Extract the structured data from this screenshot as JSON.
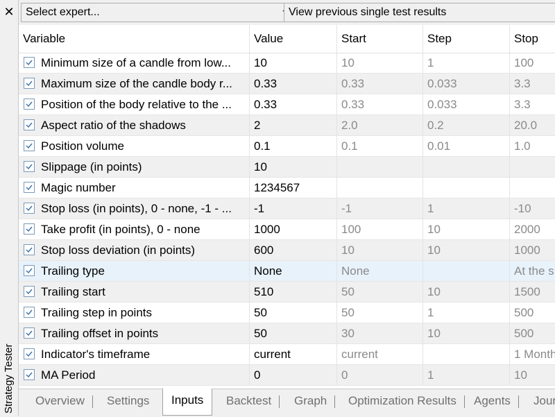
{
  "panel": {
    "title": "Strategy Tester",
    "close": "✕"
  },
  "toolbar": {
    "expert_select": "Select expert...",
    "view_prev": "View previous single test results"
  },
  "columns": [
    "Variable",
    "Value",
    "Start",
    "Step",
    "Stop"
  ],
  "rows": [
    {
      "variable": "Minimum size of a candle from low...",
      "value": "10",
      "start": "10",
      "step": "1",
      "stop": "100",
      "checked": true
    },
    {
      "variable": "Maximum size of the candle body r...",
      "value": "0.33",
      "start": "0.33",
      "step": "0.033",
      "stop": "3.3",
      "checked": true
    },
    {
      "variable": "Position of the body relative to the ...",
      "value": "0.33",
      "start": "0.33",
      "step": "0.033",
      "stop": "3.3",
      "checked": true
    },
    {
      "variable": "Aspect ratio of the shadows",
      "value": "2",
      "start": "2.0",
      "step": "0.2",
      "stop": "20.0",
      "checked": true
    },
    {
      "variable": "Position volume",
      "value": "0.1",
      "start": "0.1",
      "step": "0.01",
      "stop": "1.0",
      "checked": true
    },
    {
      "variable": "Slippage (in points)",
      "value": "10",
      "start": "",
      "step": "",
      "stop": "",
      "checked": true
    },
    {
      "variable": "Magic number",
      "value": "1234567",
      "start": "",
      "step": "",
      "stop": "",
      "checked": true
    },
    {
      "variable": "Stop loss (in points), 0 - none, -1 - ...",
      "value": "-1",
      "start": "-1",
      "step": "1",
      "stop": "-10",
      "checked": true
    },
    {
      "variable": "Take profit (in points), 0 - none",
      "value": "1000",
      "start": "100",
      "step": "10",
      "stop": "2000",
      "checked": true
    },
    {
      "variable": "Stop loss deviation (in points)",
      "value": "600",
      "start": "10",
      "step": "10",
      "stop": "1000",
      "checked": true
    },
    {
      "variable": "Trailing type",
      "value": "None",
      "start": "None",
      "step": "",
      "stop": "At the s",
      "checked": true,
      "selected": true
    },
    {
      "variable": "Trailing start",
      "value": "510",
      "start": "50",
      "step": "10",
      "stop": "1500",
      "checked": true
    },
    {
      "variable": "Trailing step in points",
      "value": "50",
      "start": "50",
      "step": "1",
      "stop": "500",
      "checked": true
    },
    {
      "variable": "Trailing offset in points",
      "value": "50",
      "start": "30",
      "step": "10",
      "stop": "500",
      "checked": true
    },
    {
      "variable": "Indicator's timeframe",
      "value": "current",
      "start": "current",
      "step": "",
      "stop": "1 Month",
      "checked": true
    },
    {
      "variable": "MA Period",
      "value": "0",
      "start": "0",
      "step": "1",
      "stop": "10",
      "checked": true
    }
  ],
  "tabs": [
    "Overview",
    "Settings",
    "Inputs",
    "Backtest",
    "Graph",
    "Optimization Results",
    "Agents",
    "Journal"
  ],
  "active_tab": "Inputs"
}
